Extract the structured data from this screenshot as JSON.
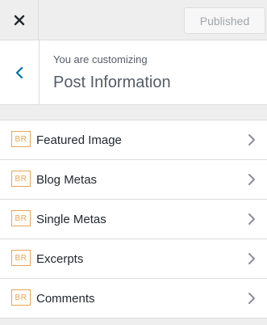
{
  "topbar": {
    "close_icon": "close-icon",
    "publish_label": "Published"
  },
  "header": {
    "back_icon": "chevron-left-icon",
    "customizing_label": "You are customizing",
    "title": "Post Information"
  },
  "sections": [
    {
      "badge": "BR",
      "label": "Featured Image",
      "icon": "chevron-right-icon"
    },
    {
      "badge": "BR",
      "label": "Blog Metas",
      "icon": "chevron-right-icon"
    },
    {
      "badge": "BR",
      "label": "Single Metas",
      "icon": "chevron-right-icon"
    },
    {
      "badge": "BR",
      "label": "Excerpts",
      "icon": "chevron-right-icon"
    },
    {
      "badge": "BR",
      "label": "Comments",
      "icon": "chevron-right-icon"
    }
  ],
  "colors": {
    "accent_blue": "#0073aa",
    "badge_orange": "#e2a75b",
    "background": "#eeeeee"
  }
}
